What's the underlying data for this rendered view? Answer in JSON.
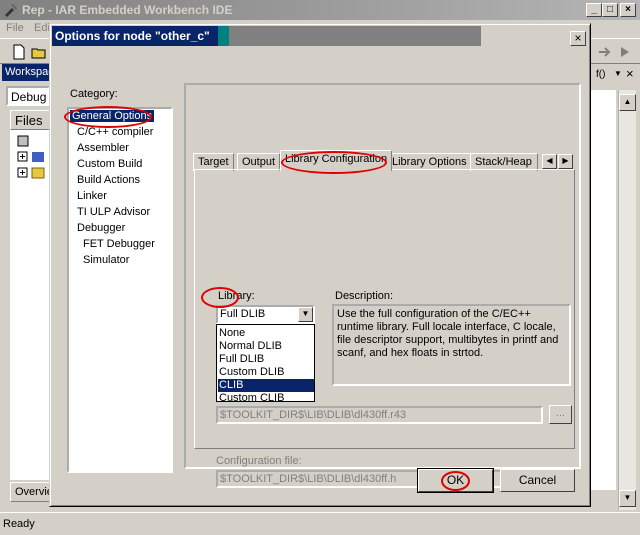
{
  "ide": {
    "title": "Rep - IAR Embedded Workbench IDE",
    "menu": [
      "File",
      "Edit"
    ],
    "workspace_label": "Workspace",
    "config_value": "Debug",
    "files_header": "Files",
    "overview_tab": "Overview",
    "right_pane_label": "f()",
    "status": "Ready"
  },
  "dialog": {
    "title_prefix": "Options for node ",
    "node_name": "\"other_c\"",
    "close_glyph": "×",
    "category_label": "Category:",
    "categories": [
      "General Options",
      "C/C++ compiler",
      "Assembler",
      "Custom Build",
      "Build Actions",
      "Linker",
      "TI ULP Advisor",
      "Debugger",
      "FET Debugger",
      "Simulator"
    ],
    "tabs": [
      "Target",
      "Output",
      "Library Configuration",
      "Library Options",
      "Stack/Heap"
    ],
    "library_label": "Library:",
    "library_value": "Full DLIB",
    "library_options": [
      "None",
      "Normal DLIB",
      "Full DLIB",
      "Custom DLIB",
      "CLIB",
      "Custom CLIB"
    ],
    "selected_option": "CLIB",
    "description_label": "Description:",
    "description_text": "Use the full configuration of the C/EC++ runtime library. Full locale interface, C locale, file descriptor support, multibytes in printf and scanf, and hex floats in strtod.",
    "library_file_path": "$TOOLKIT_DIR$\\LIB\\DLIB\\dl430ff.r43",
    "config_file_label": "Configuration file:",
    "config_file_path": "$TOOLKIT_DIR$\\LIB\\DLIB\\dl430ff.h",
    "browse_label": "...",
    "ok_label": "OK",
    "cancel_label": "Cancel"
  },
  "colors": {
    "selection": "#0a246a",
    "annotation": "#e00000",
    "face": "#d4d0c8"
  }
}
